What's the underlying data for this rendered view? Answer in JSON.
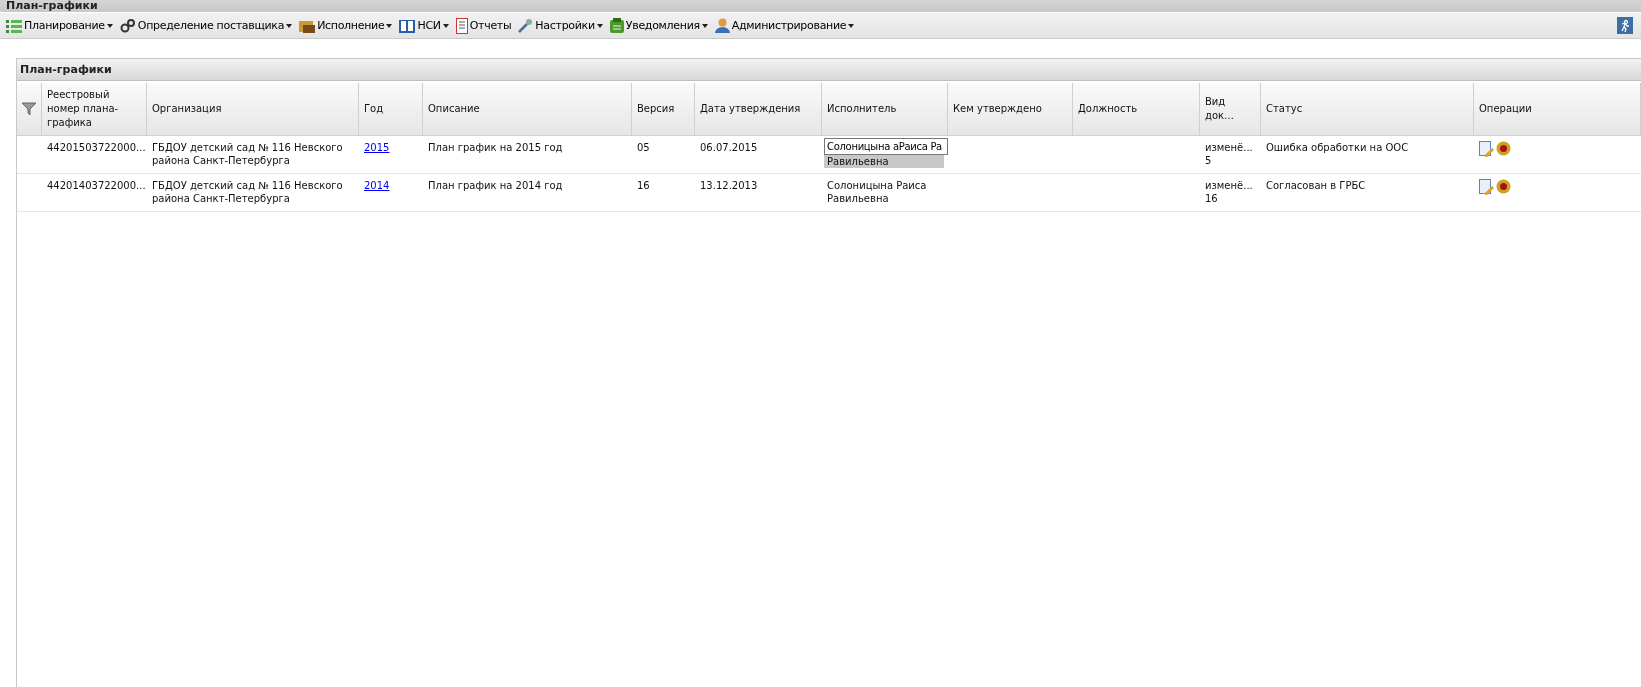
{
  "window": {
    "title": "План-графики"
  },
  "menu": [
    {
      "label": "Планирование",
      "dropdown": true
    },
    {
      "label": "Определение поставщика",
      "dropdown": true
    },
    {
      "label": "Исполнение",
      "dropdown": true
    },
    {
      "label": "НСИ",
      "dropdown": true
    },
    {
      "label": "Отчеты",
      "dropdown": false
    },
    {
      "label": "Настройки",
      "dropdown": true
    },
    {
      "label": "Уведомления",
      "dropdown": true
    },
    {
      "label": "Администрирование",
      "dropdown": true
    }
  ],
  "panel": {
    "title": "План-графики"
  },
  "table": {
    "columns": [
      "Реестровый номер плана-графика",
      "Организация",
      "Год",
      "Описание",
      "Версия",
      "Дата утверждения",
      "Исполнитель",
      "Кем утверждено",
      "Должность",
      "Вид док…",
      "Статус",
      "Операции"
    ],
    "rows": [
      {
        "number": "44201503722000...",
        "organization": "ГБДОУ детский сад № 116 Невского района Санкт-Петербурга",
        "year": "2015",
        "description": "План график на 2015 год",
        "version": "05",
        "date": "06.07.2015",
        "executor": "Равильевна",
        "executor_edit": "Солоницына аРаиса Ра",
        "doc_type": "изменё... 5",
        "status": "Ошибка обработки на ООС"
      },
      {
        "number": "44201403722000...",
        "organization": "ГБДОУ детский сад № 116 Невского района Санкт-Петербурга",
        "year": "2014",
        "description": "План график на 2014 год",
        "version": "16",
        "date": "13.12.2013",
        "executor": "Солоницына Раиса Равильевна",
        "doc_type": "изменё... 16",
        "status": "Согласован в ГРБС"
      }
    ]
  }
}
